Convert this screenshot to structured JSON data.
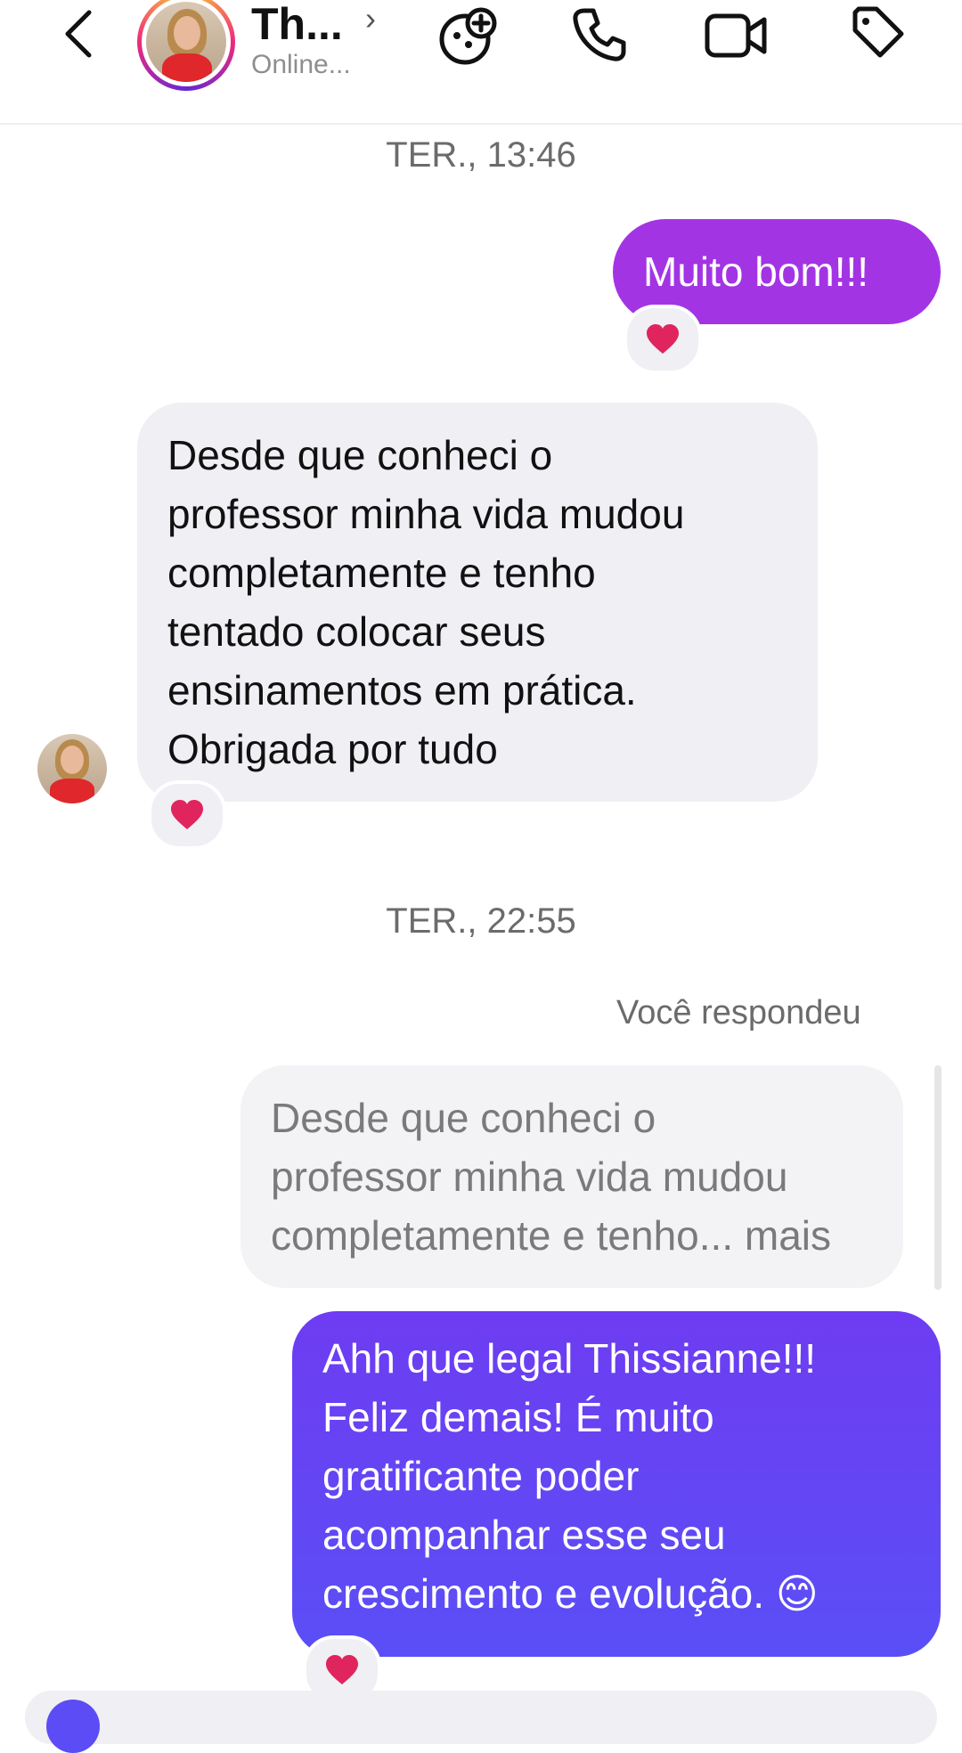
{
  "header": {
    "name": "Th...",
    "status": "Online...",
    "icons": [
      "back-icon",
      "effects-icon",
      "phone-icon",
      "video-icon",
      "tag-icon"
    ]
  },
  "timestamps": [
    "TER., 13:46",
    "TER., 22:55"
  ],
  "messages": {
    "sent1": {
      "lines": [
        "Muito bom!!!"
      ],
      "reaction": "❤️"
    },
    "received": {
      "lines": [
        "Desde que conheci o",
        "professor minha vida mudou",
        "completamente e tenho",
        "tentado colocar seus",
        "ensinamentos em prática.",
        "Obrigada por tudo"
      ],
      "reaction": "❤️"
    },
    "reply_label": "Você respondeu",
    "quote": {
      "lines": [
        "Desde que conheci o",
        "professor minha vida mudou",
        "completamente e tenho... mais"
      ]
    },
    "sent2": {
      "lines": [
        "Ahh que legal Thissianne!!!",
        "Feliz demais! É muito",
        "gratificante poder",
        "acompanhar esse seu",
        "crescimento e evolução. 😊"
      ],
      "reaction": "❤️"
    }
  },
  "colors": {
    "sent1": "#a334e4",
    "sent2": "#5a4ff6",
    "received": "#efeff4",
    "heart": "#e0245e"
  }
}
